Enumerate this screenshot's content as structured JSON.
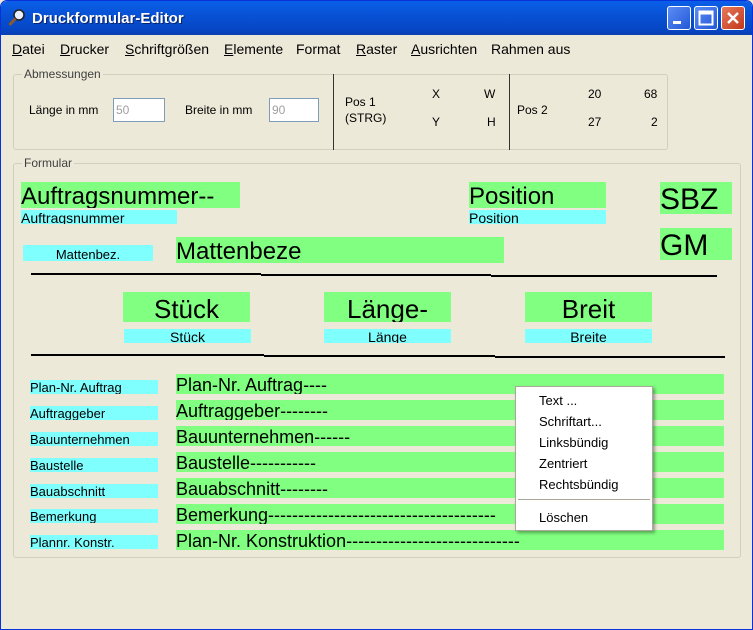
{
  "window": {
    "title": "Druckformular-Editor"
  },
  "menu": [
    {
      "u": "D",
      "rest": "atei"
    },
    {
      "u": "D",
      "rest": "rucker"
    },
    {
      "u": "S",
      "rest": "chriftgrößen"
    },
    {
      "u": "E",
      "rest": "lemente"
    },
    {
      "u": "",
      "rest": "Format"
    },
    {
      "u": "R",
      "rest": "aster"
    },
    {
      "u": "A",
      "rest": "usrichten"
    },
    {
      "u": "",
      "rest": "Rahmen aus"
    }
  ],
  "dimensions": {
    "legend": "Abmessungen",
    "length_label": "Länge in mm",
    "length_value": "50",
    "width_label": "Breite in mm",
    "width_value": "90",
    "pos1_label": "Pos 1",
    "pos1_sub": "(STRG)",
    "x_label": "X",
    "y_label": "Y",
    "w_label": "W",
    "h_label": "H",
    "pos2_label": "Pos 2",
    "pos2_x": "20",
    "pos2_w": "68",
    "pos2_y": "27",
    "pos2_h": "2"
  },
  "form": {
    "legend": "Formular",
    "auftrag_field": "Auftragsnummer--",
    "auftrag_label": "Auftragsnummer",
    "position_field": "Position",
    "position_label": "Position",
    "sbz": "SBZ",
    "gm": "GM",
    "matten_label": "Mattenbez.",
    "matten_field": "Mattenbeze",
    "stueck_field": "Stück",
    "stueck_label": "Stück",
    "laenge_field": "Länge-",
    "laenge_label": "Länge",
    "breit_field": "Breit",
    "breite_label": "Breite",
    "rows": [
      {
        "label": "Plan-Nr. Auftrag",
        "field": "Plan-Nr. Auftrag----"
      },
      {
        "label": "Auftraggeber",
        "field": "Auftraggeber--------"
      },
      {
        "label": "Bauunternehmen",
        "field": "Bauunternehmen------"
      },
      {
        "label": "Baustelle",
        "field": "Baustelle-----------"
      },
      {
        "label": "Bauabschnitt",
        "field": "Bauabschnitt--------"
      },
      {
        "label": "Bemerkung",
        "field": "Bemerkung--------------------------------------"
      },
      {
        "label": "Plannr. Konstr.",
        "field": "Plan-Nr. Konstruktion-----------------------------"
      }
    ]
  },
  "context_menu": {
    "items": [
      "Text ...",
      "Schriftart...",
      "Linksbündig",
      "Zentriert",
      "Rechtsbündig"
    ],
    "delete": "Löschen"
  },
  "colors": {
    "field_green": "#80ff80",
    "label_cyan": "#80ffff",
    "titlebar": "#0852d6"
  }
}
